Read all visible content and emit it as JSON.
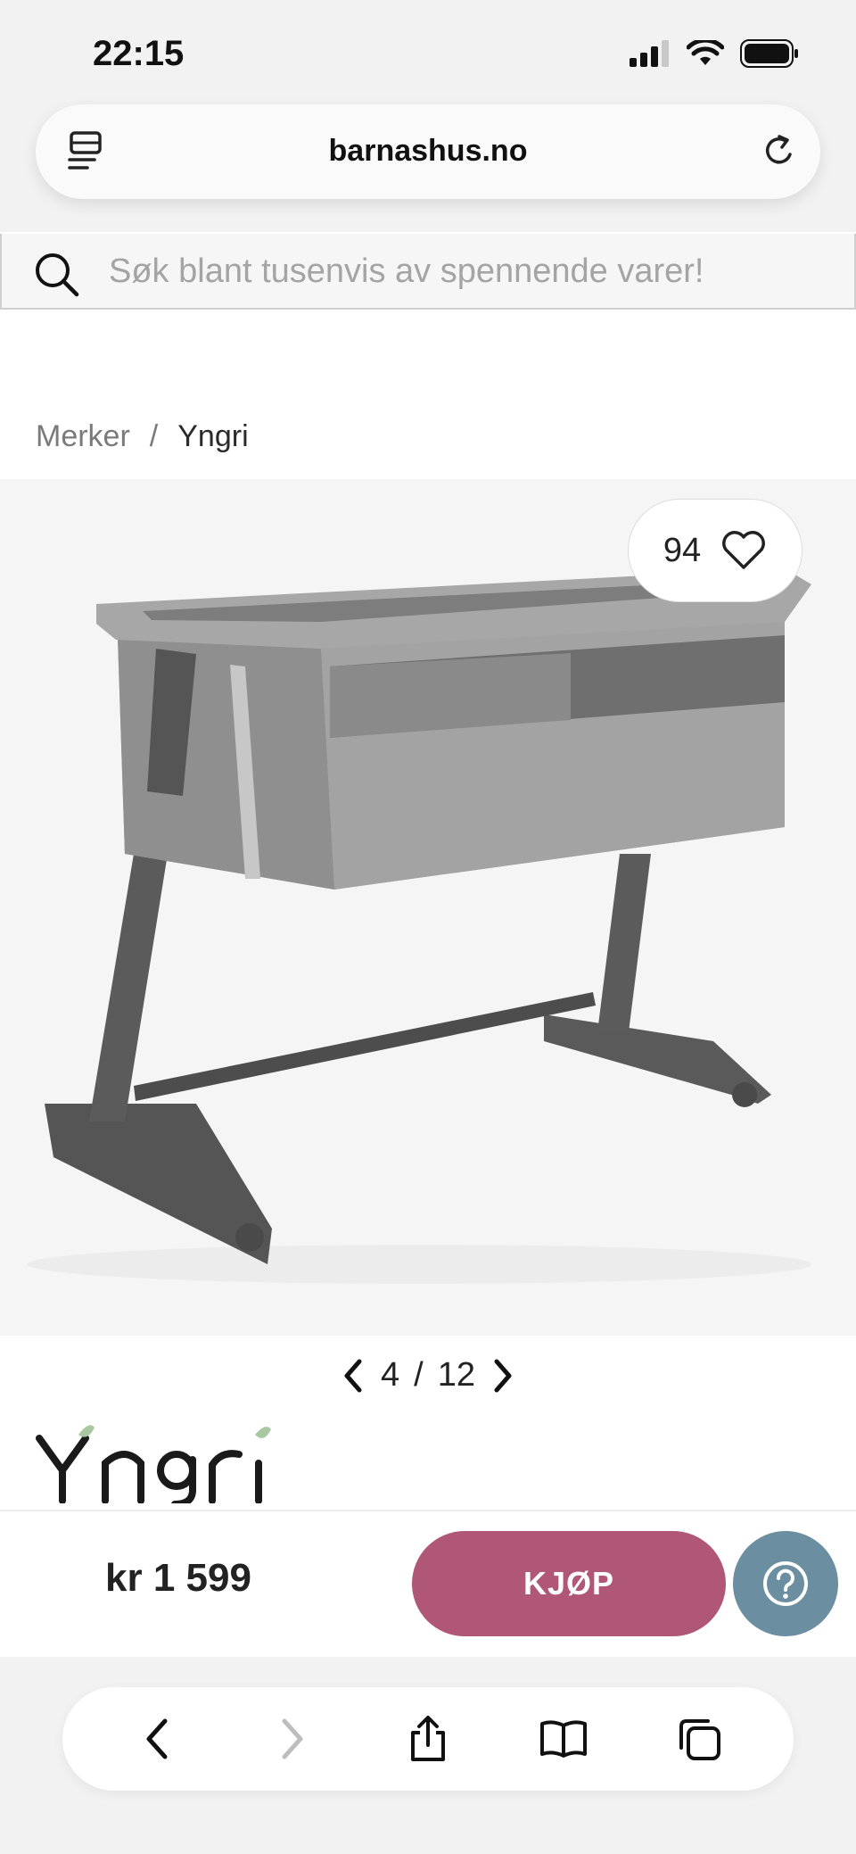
{
  "status_bar": {
    "time": "22:15"
  },
  "browser": {
    "url": "barnashus.no"
  },
  "search": {
    "placeholder": "Søk blant tusenvis av spennende varer!"
  },
  "breadcrumb": {
    "items": [
      "Merker",
      "Yngri"
    ],
    "separator": "/"
  },
  "product": {
    "favorites_count": "94",
    "image_index": "4",
    "image_total": "12",
    "brand": "Yngri",
    "price": "kr 1 599"
  },
  "actions": {
    "buy_label": "KJØP"
  },
  "colors": {
    "buy": "#b05676",
    "help": "#6b8fa0",
    "brand_leaf": "#a9c7a0"
  },
  "icons": {
    "tabs": "tab-overview-icon",
    "reload": "reload-icon",
    "search": "search-icon",
    "favorite": "heart-icon",
    "help": "question-icon",
    "back": "chevron-left-icon",
    "forward": "chevron-right-icon",
    "share": "share-icon",
    "bookmarks": "book-icon",
    "tabs_bottom": "tabs-icon"
  }
}
